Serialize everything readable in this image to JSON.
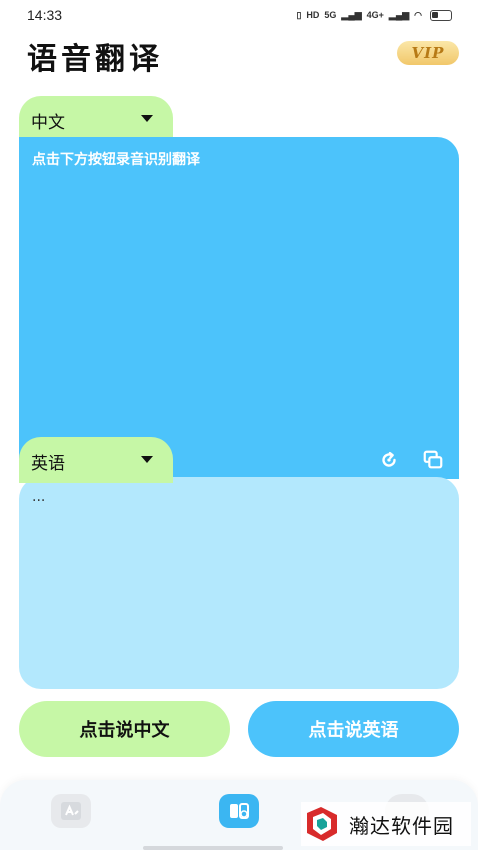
{
  "status_bar": {
    "time": "14:33",
    "indicators": [
      "HD",
      "5G",
      "4G+"
    ]
  },
  "header": {
    "title": "语音翻译",
    "vip_label": "VIP"
  },
  "source": {
    "language": "中文",
    "hint": "点击下方按钮录音识别翻译"
  },
  "target": {
    "language": "英语",
    "text": "..."
  },
  "actions": {
    "speak_chinese": "点击说中文",
    "speak_english": "点击说英语"
  },
  "watermark": {
    "text": "瀚达软件园"
  },
  "colors": {
    "green": "#c6f7a6",
    "blue": "#4cc3fb",
    "light_blue": "#b3e8fd",
    "vip_gold": "#f1c76a"
  },
  "icons": {
    "refresh": "refresh-icon",
    "copy": "copy-icon",
    "nav_text": "text-translate-icon",
    "nav_voice": "voice-translate-icon"
  }
}
